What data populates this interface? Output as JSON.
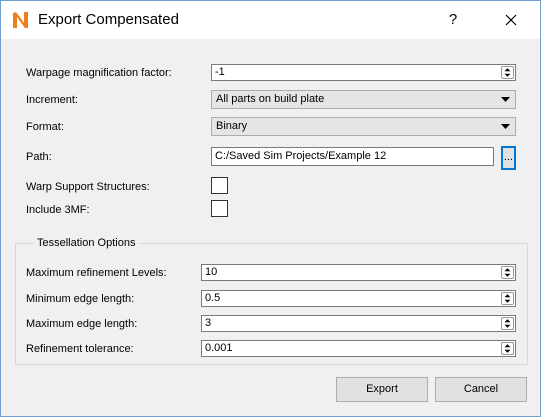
{
  "window": {
    "title": "Export Compensated",
    "help_label": "?"
  },
  "icons": {
    "app_icon": "netfabb-n-logo",
    "close_icon": "close-x",
    "dropdown_arrow": "triangle-down",
    "spin_arrows": "up-down-arrows"
  },
  "colors": {
    "app_icon_orange": "#ef7d1a",
    "window_border": "#6f9fce",
    "focus_blue": "#0078d7"
  },
  "form": {
    "warpage": {
      "label": "Warpage magnification factor:",
      "value": "-1"
    },
    "increment": {
      "label": "Increment:",
      "value": "All parts on build plate"
    },
    "format": {
      "label": "Format:",
      "value": "Binary"
    },
    "path": {
      "label": "Path:",
      "value": "C:/Saved Sim Projects/Example 12",
      "browse_label": "..."
    },
    "warp_support": {
      "label": "Warp Support Structures:",
      "checked": false
    },
    "include_3mf": {
      "label": "Include 3MF:",
      "checked": false
    }
  },
  "tessellation": {
    "title": "Tessellation Options",
    "max_levels": {
      "label": "Maximum refinement Levels:",
      "value": "10"
    },
    "min_edge": {
      "label": "Minimum edge length:",
      "value": "0.5"
    },
    "max_edge": {
      "label": "Maximum edge length:",
      "value": "3"
    },
    "tolerance": {
      "label": "Refinement tolerance:",
      "value": "0.001"
    }
  },
  "buttons": {
    "export": "Export",
    "cancel": "Cancel"
  }
}
